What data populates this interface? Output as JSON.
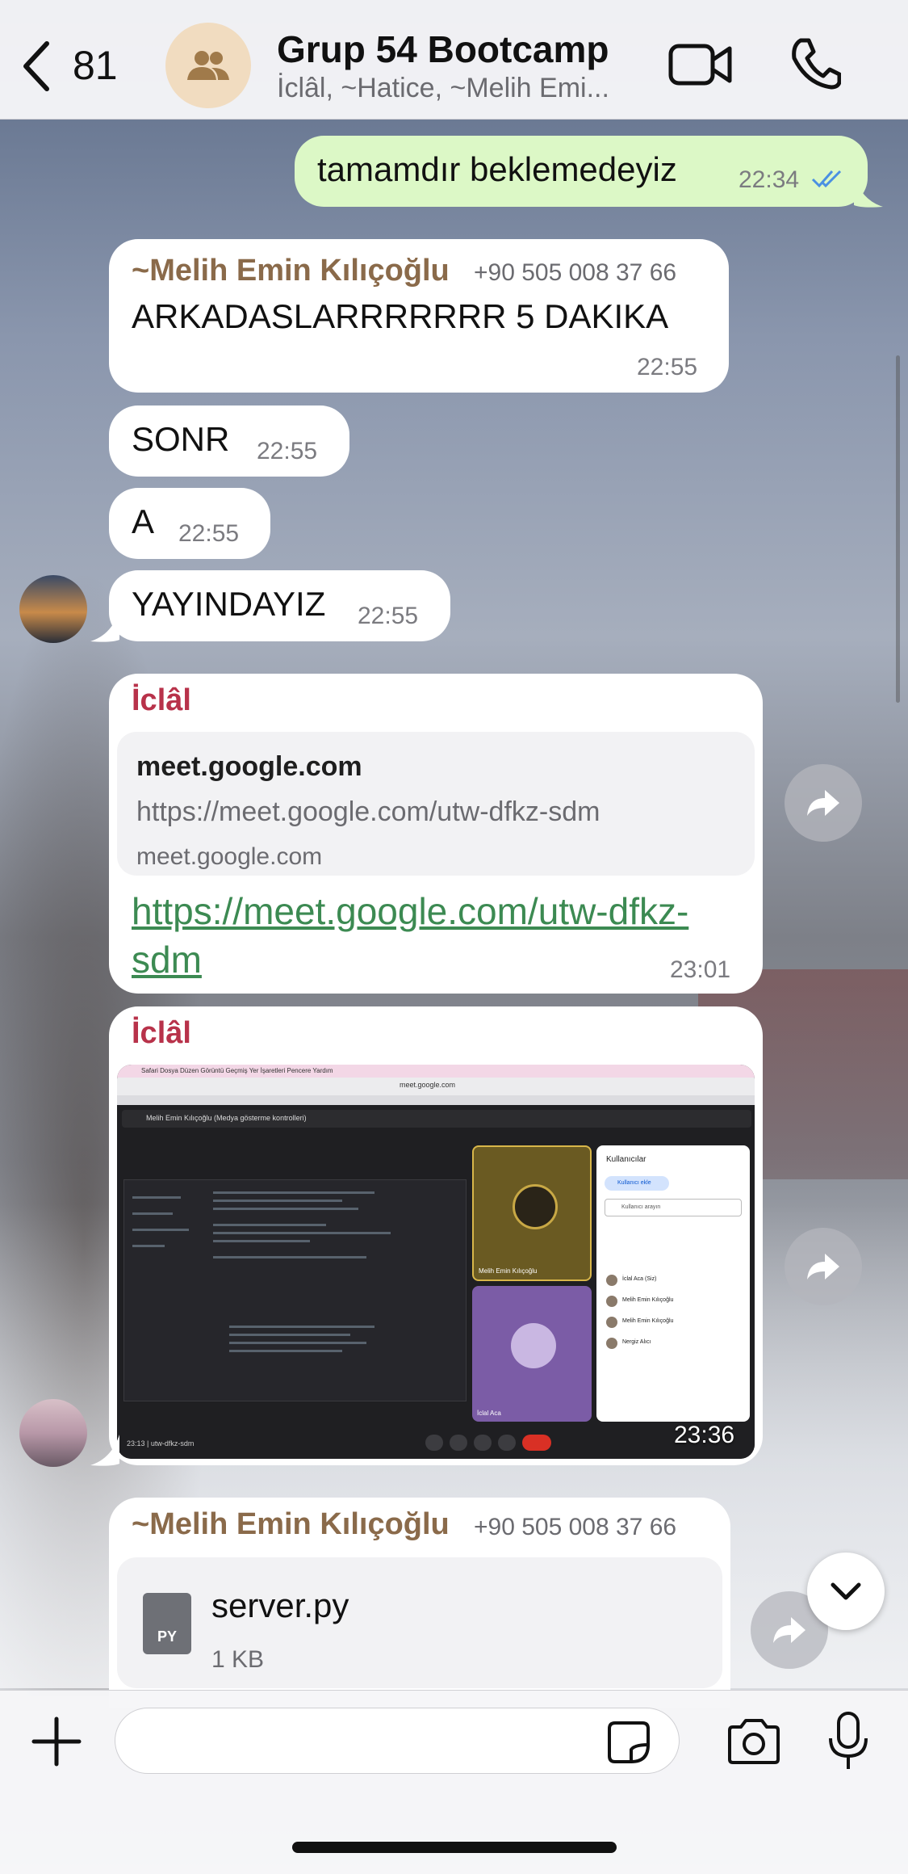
{
  "header": {
    "back_count": "81",
    "title": "Grup 54 Bootcamp",
    "subtitle": "İclâl, ~Hatice, ~Melih Emi..."
  },
  "messages": {
    "m1": {
      "text": "tamamdır beklemedeyiz",
      "time": "22:34"
    },
    "m2": {
      "sender": "~Melih Emin Kılıçoğlu",
      "phone": "+90 505 008 37 66",
      "text": "ARKADASLARRRRRRR 5 DAKIKA",
      "time": "22:55"
    },
    "m3": {
      "text": "SONR",
      "time": "22:55"
    },
    "m4": {
      "text": "A",
      "time": "22:55"
    },
    "m5": {
      "text": "YAYINDAYIZ",
      "time": "22:55"
    },
    "m6": {
      "sender": "İclâl",
      "link_title": "meet.google.com",
      "link_url": "https://meet.google.com/utw-dfkz-sdm",
      "link_domain": "meet.google.com",
      "link_text": "https://meet.google.com/utw-dfkz-sdm",
      "time": "23:01"
    },
    "m7": {
      "sender": "İclâl",
      "time": "23:36",
      "screenshot": {
        "menubar": "Safari   Dosya   Düzen   Görüntü   Geçmiş   Yer İşaretleri   Pencere   Yardım",
        "url": "meet.google.com",
        "meet_title": "Melih Emin Kılıçoğlu (Medya gösterme kontrolleri)",
        "tile1": "Melih Emin Kılıçoğlu",
        "tile2": "İclal Aca",
        "panel_title": "Kullanıcılar",
        "panel_add": "Kullanıcı ekle",
        "panel_search": "Kullanıcı arayın",
        "panel_people": [
          "İclal Aca (Siz)",
          "Melih Emin Kılıçoğlu",
          "Melih Emin Kılıçoğlu",
          "Nergiz Alıcı"
        ],
        "meet_code": "23:13 | utw-dfkz-sdm"
      }
    },
    "m8": {
      "sender": "~Melih Emin Kılıçoğlu",
      "phone": "+90 505 008 37 66",
      "file_ext": "PY",
      "file_name": "server.py",
      "file_size": "1 KB"
    }
  },
  "colors": {
    "outgoing_bubble": "#dcf8c6",
    "incoming_bubble": "#ffffff",
    "sender_melih": "#8a6a4a",
    "sender_iclal": "#b8324a",
    "link": "#3c8a52",
    "read_ticks": "#4a90e2"
  },
  "icons": {
    "back": "chevron-left-icon",
    "group": "group-avatar-icon",
    "video": "video-call-icon",
    "call": "phone-call-icon",
    "forward": "forward-icon",
    "scroll_down": "chevron-down-icon",
    "attach": "plus-icon",
    "sticker": "sticker-icon",
    "camera": "camera-icon",
    "mic": "microphone-icon",
    "file": "file-icon"
  }
}
